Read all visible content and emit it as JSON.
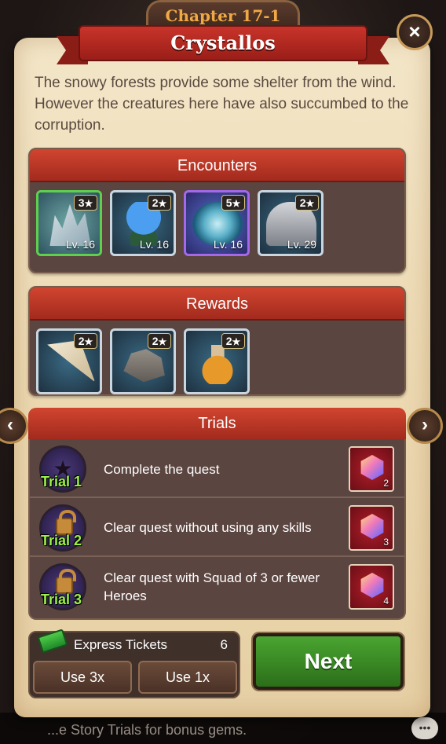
{
  "header": {
    "chapter": "Chapter 17-1",
    "title": "Crystallos"
  },
  "description": "The snowy forests provide some shelter from the wind. However the creatures here have also succumbed to the corruption.",
  "encounters": {
    "title": "Encounters",
    "items": [
      {
        "name": "ice-crystal-monster-icon",
        "stars": "3",
        "level": "Lv. 16",
        "rarity_color": "#5ed04d"
      },
      {
        "name": "blue-mushroom-monster-icon",
        "stars": "2",
        "level": "Lv. 16",
        "rarity_color": "#c9d6e0"
      },
      {
        "name": "ice-vortex-monster-icon",
        "stars": "5",
        "level": "Lv. 16",
        "rarity_color": "#a468e8"
      },
      {
        "name": "armored-knight-monster-icon",
        "stars": "2",
        "level": "Lv. 29",
        "rarity_color": "#c9d6e0"
      }
    ]
  },
  "rewards": {
    "title": "Rewards",
    "items": [
      {
        "name": "fang-icon",
        "stars": "2"
      },
      {
        "name": "rock-ore-icon",
        "stars": "2"
      },
      {
        "name": "potion-bottle-icon",
        "stars": "2"
      }
    ]
  },
  "trials": {
    "title": "Trials",
    "items": [
      {
        "label": "Trial 1",
        "text": "Complete the quest",
        "gems": "2",
        "locked": false
      },
      {
        "label": "Trial 2",
        "text": "Clear quest without using any skills",
        "gems": "3",
        "locked": true
      },
      {
        "label": "Trial 3",
        "text": "Clear quest with Squad of 3 or fewer Heroes",
        "gems": "4",
        "locked": true
      }
    ]
  },
  "express": {
    "label": "Express Tickets",
    "count": "6",
    "use3": "Use 3x",
    "use1": "Use 1x"
  },
  "next_label": "Next",
  "close_symbol": "×",
  "nav": {
    "prev": "‹",
    "next": "›"
  },
  "bottom_hint": "...e Story Trials for bonus gems.",
  "chat_symbol": "•••"
}
